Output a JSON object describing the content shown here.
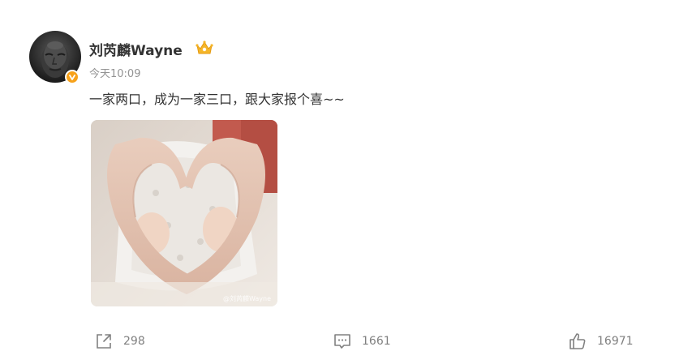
{
  "post": {
    "author": "刘芮麟Wayne",
    "timestamp": "今天10:09",
    "text": "一家两口，成为一家三口，跟大家报个喜~~",
    "image_watermark": "@刘芮麟Wayne"
  },
  "actions": {
    "share_count": "298",
    "comment_count": "1661",
    "like_count": "16971"
  },
  "icons": {
    "share": "share-icon",
    "comment": "comment-icon",
    "like": "thumbs-up-icon",
    "verified": "verified-badge-icon",
    "vip": "crown-icon"
  },
  "colors": {
    "verified_badge": "#f7a21b",
    "muted_text": "#939393",
    "action_gray": "#808080"
  }
}
